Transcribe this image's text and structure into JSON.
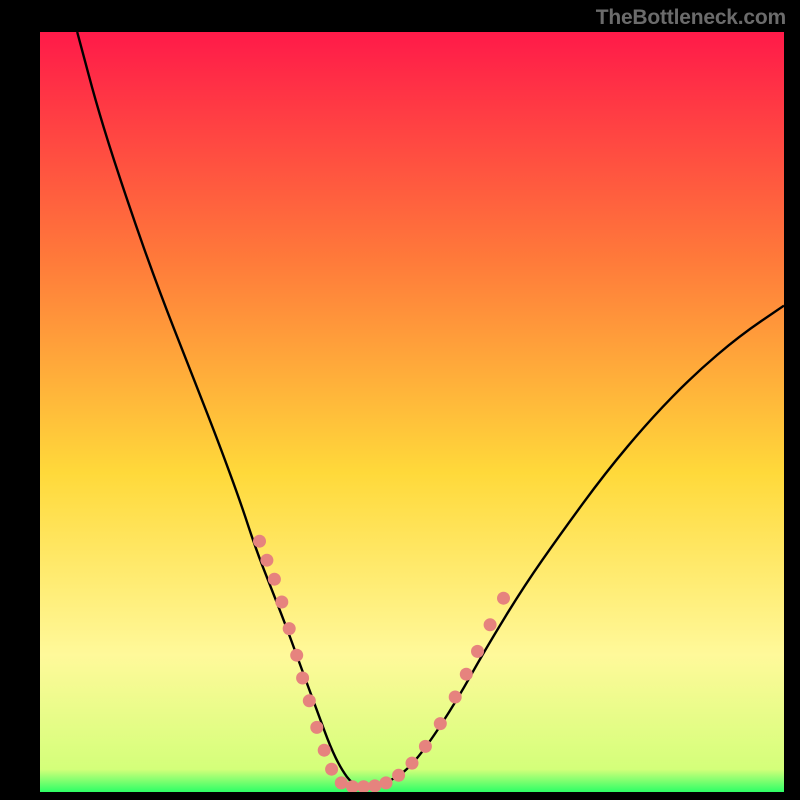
{
  "watermark": "TheBottleneck.com",
  "colors": {
    "background": "#000000",
    "gradient_top": "#ff1a49",
    "gradient_mid_upper": "#ff7a3a",
    "gradient_mid": "#ffd93a",
    "gradient_mid_lower": "#fff99a",
    "gradient_bottom": "#2dff66",
    "curve": "#000000",
    "dot": "#e6837e",
    "watermark": "#6b6b6b"
  },
  "chart_data": {
    "type": "line",
    "title": "",
    "xlabel": "",
    "ylabel": "",
    "xlim": [
      0,
      100
    ],
    "ylim": [
      0,
      100
    ],
    "series": [
      {
        "name": "bottleneck-curve",
        "x": [
          5,
          8,
          12,
          16,
          20,
          24,
          27,
          29,
          31,
          33,
          34.5,
          36,
          37.5,
          39,
          40.5,
          42,
          44,
          46,
          49,
          52,
          56,
          60,
          65,
          70,
          76,
          82,
          88,
          94,
          100
        ],
        "y": [
          100,
          89,
          77,
          66,
          56,
          46,
          38,
          32,
          27,
          22,
          18,
          14,
          10,
          6,
          3,
          1,
          0.5,
          1,
          2.5,
          6,
          12,
          19,
          27,
          34,
          42,
          49,
          55,
          60,
          64
        ]
      }
    ],
    "highlight_dots": {
      "name": "marker-dots",
      "points": [
        [
          29.5,
          33
        ],
        [
          30.5,
          30.5
        ],
        [
          31.5,
          28
        ],
        [
          32.5,
          25
        ],
        [
          33.5,
          21.5
        ],
        [
          34.5,
          18
        ],
        [
          35.3,
          15
        ],
        [
          36.2,
          12
        ],
        [
          37.2,
          8.5
        ],
        [
          38.2,
          5.5
        ],
        [
          39.2,
          3
        ],
        [
          40.5,
          1.2
        ],
        [
          42,
          0.7
        ],
        [
          43.5,
          0.7
        ],
        [
          45,
          0.8
        ],
        [
          46.5,
          1.2
        ],
        [
          48.2,
          2.2
        ],
        [
          50,
          3.8
        ],
        [
          51.8,
          6
        ],
        [
          53.8,
          9
        ],
        [
          55.8,
          12.5
        ],
        [
          57.3,
          15.5
        ],
        [
          58.8,
          18.5
        ],
        [
          60.5,
          22
        ],
        [
          62.3,
          25.5
        ]
      ]
    }
  }
}
